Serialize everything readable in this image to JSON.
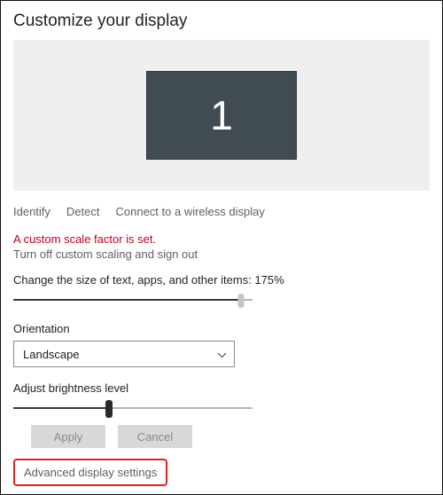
{
  "title": "Customize your display",
  "monitor": {
    "number": "1"
  },
  "links": {
    "identify": "Identify",
    "detect": "Detect",
    "wireless": "Connect to a wireless display"
  },
  "scaling": {
    "warning": "A custom scale factor is set.",
    "turn_off": "Turn off custom scaling and sign out",
    "size_label_prefix": "Change the size of text, apps, and other items: ",
    "size_value": "175%",
    "slider_percent": 95
  },
  "orientation": {
    "label": "Orientation",
    "value": "Landscape"
  },
  "brightness": {
    "label": "Adjust brightness level",
    "slider_percent": 40
  },
  "buttons": {
    "apply": "Apply",
    "cancel": "Cancel"
  },
  "advanced": "Advanced display settings"
}
